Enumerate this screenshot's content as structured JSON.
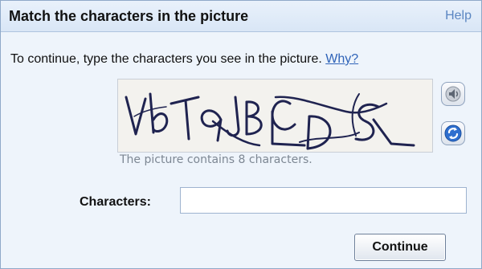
{
  "header": {
    "title": "Match the characters in the picture",
    "help_label": "Help"
  },
  "instruction": {
    "text": "To continue, type the characters you see in the picture. ",
    "why_label": "Why?"
  },
  "captcha": {
    "hint": "The picture contains 8 characters.",
    "audio_icon": "speaker-icon",
    "refresh_icon": "refresh-icon"
  },
  "form": {
    "characters_label": "Characters:",
    "characters_value": "",
    "continue_label": "Continue"
  },
  "colors": {
    "accent": "#2f63b8",
    "captcha_ink": "#1f2350",
    "panel_bg": "#eef4fb"
  }
}
